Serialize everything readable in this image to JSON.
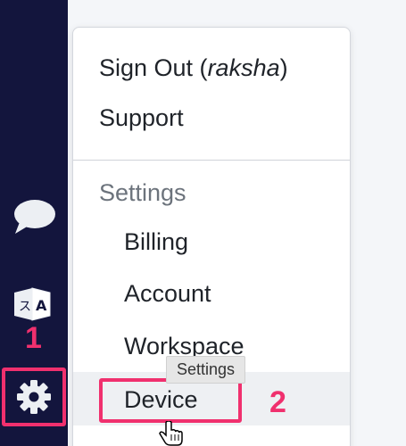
{
  "sidebar": {
    "icons": [
      "chat-bubble-icon",
      "translate-icon",
      "gear-icon"
    ]
  },
  "menu": {
    "sign_out_prefix": "Sign Out (",
    "sign_out_user": "raksha",
    "sign_out_suffix": ")",
    "support": "Support",
    "settings_header": "Settings",
    "settings_items": [
      "Billing",
      "Account",
      "Workspace",
      "Device"
    ]
  },
  "tooltip": "Settings",
  "annotations": {
    "step_1": "1",
    "step_2": "2",
    "highlight_color": "#f0306e"
  },
  "colors": {
    "sidebar_bg": "#13153d",
    "menu_bg": "#ffffff",
    "hover_row": "#eef0f3"
  }
}
